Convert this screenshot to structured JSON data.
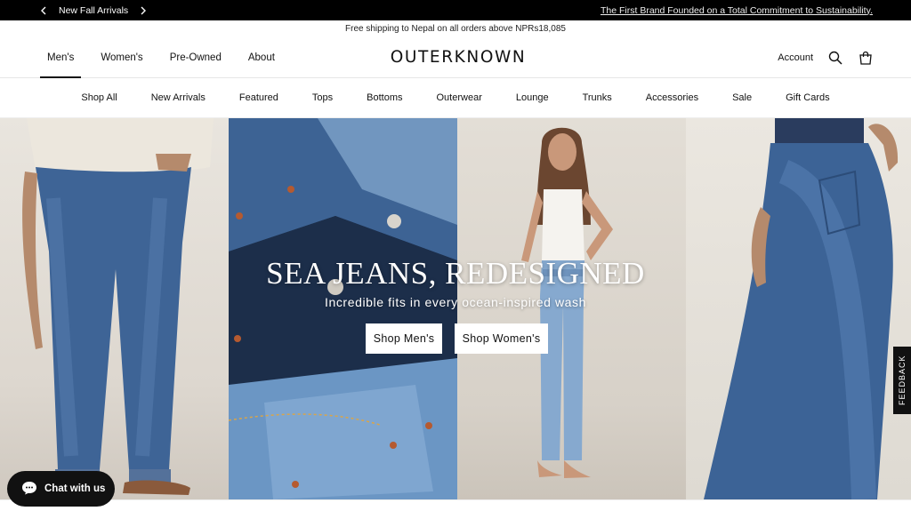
{
  "announcement": {
    "left_text": "New Fall Arrivals",
    "right_text": "The First Brand Founded on a Total Commitment to Sustainability."
  },
  "shipping": {
    "text": "Free shipping to Nepal on all orders above NPRs18,085"
  },
  "header": {
    "logo": "OUTERKNOWN",
    "nav": [
      "Men's",
      "Women's",
      "Pre-Owned",
      "About"
    ],
    "account": "Account"
  },
  "subnav": [
    "Shop All",
    "New Arrivals",
    "Featured",
    "Tops",
    "Bottoms",
    "Outerwear",
    "Lounge",
    "Trunks",
    "Accessories",
    "Sale",
    "Gift Cards"
  ],
  "hero": {
    "title": "SEA JEANS, REDESIGNED",
    "subtitle": "Incredible fits in every ocean-inspired wash",
    "btn_men": "Shop Men's",
    "btn_women": "Shop Women's"
  },
  "feedback": "FEEDBACK",
  "chat": {
    "label": "Chat with us"
  }
}
